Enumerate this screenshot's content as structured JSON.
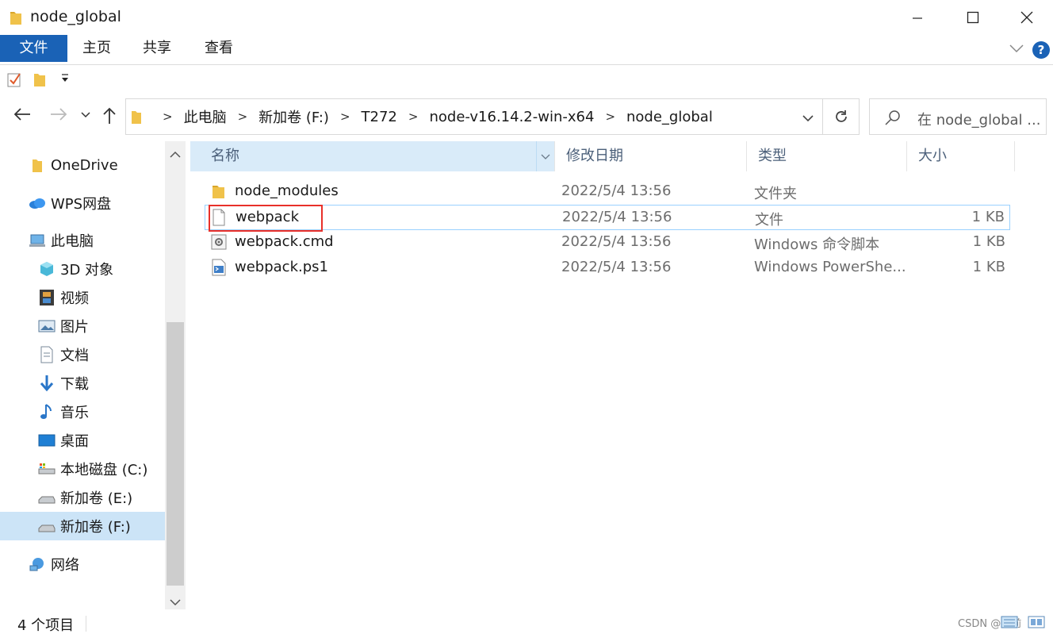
{
  "window": {
    "title": "node_global"
  },
  "ribbon": {
    "tabs": [
      "文件",
      "主页",
      "共享",
      "查看"
    ]
  },
  "address": {
    "crumbs": [
      "此电脑",
      "新加卷 (F:)",
      "T272",
      "node-v16.14.2-win-x64",
      "node_global"
    ]
  },
  "search": {
    "placeholder": "在 node_global ..."
  },
  "sidebar": {
    "items": [
      {
        "label": "OneDrive",
        "icon": "folder-icon"
      },
      {
        "label": "WPS网盘",
        "icon": "cloud-icon"
      },
      {
        "label": "此电脑",
        "icon": "computer-icon"
      },
      {
        "label": "3D 对象",
        "icon": "cube-icon"
      },
      {
        "label": "视频",
        "icon": "film-icon"
      },
      {
        "label": "图片",
        "icon": "picture-icon"
      },
      {
        "label": "文档",
        "icon": "document-icon"
      },
      {
        "label": "下载",
        "icon": "download-icon"
      },
      {
        "label": "音乐",
        "icon": "music-icon"
      },
      {
        "label": "桌面",
        "icon": "desktop-icon"
      },
      {
        "label": "本地磁盘 (C:)",
        "icon": "drive-icon"
      },
      {
        "label": "新加卷 (E:)",
        "icon": "drive-icon"
      },
      {
        "label": "新加卷 (F:)",
        "icon": "drive-icon",
        "selected": true
      },
      {
        "label": "网络",
        "icon": "network-icon"
      }
    ]
  },
  "columns": {
    "name": "名称",
    "date": "修改日期",
    "type": "类型",
    "size": "大小"
  },
  "files": [
    {
      "name": "node_modules",
      "date": "2022/5/4 13:56",
      "type": "文件夹",
      "size": "",
      "icon": "folder-icon"
    },
    {
      "name": "webpack",
      "date": "2022/5/4 13:56",
      "type": "文件",
      "size": "1 KB",
      "icon": "file-icon",
      "highlighted": true
    },
    {
      "name": "webpack.cmd",
      "date": "2022/5/4 13:56",
      "type": "Windows 命令脚本",
      "size": "1 KB",
      "icon": "cmd-script-icon"
    },
    {
      "name": "webpack.ps1",
      "date": "2022/5/4 13:56",
      "type": "Windows PowerShe...",
      "size": "1 KB",
      "icon": "powershell-script-icon"
    }
  ],
  "status": {
    "item_count": "4 个项目",
    "watermark": "CSDN @睡前"
  },
  "colors": {
    "accent": "#1a62b6",
    "selection": "#cce4f7",
    "highlight_box": "#e8302a",
    "folder": "#f0c24a"
  }
}
